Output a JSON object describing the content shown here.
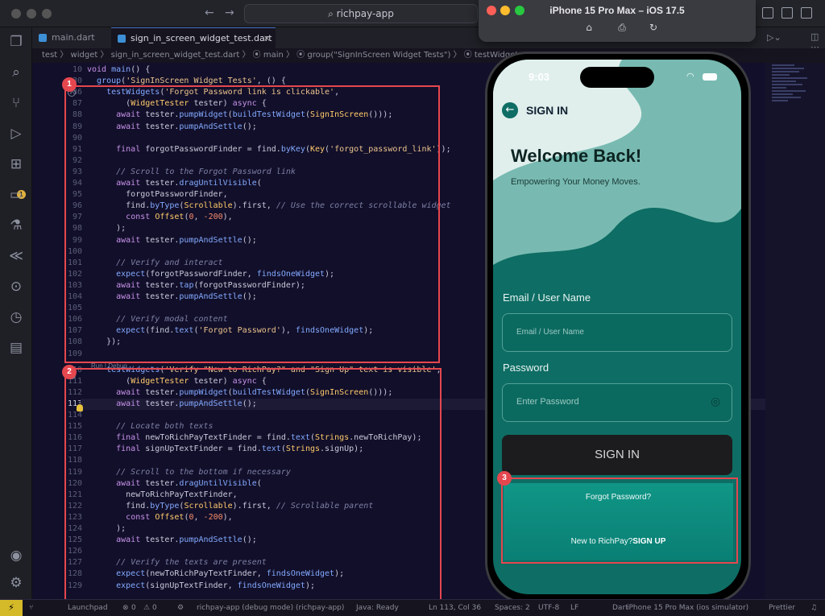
{
  "window": {
    "search": "richpay-app"
  },
  "tabs": [
    {
      "label": "main.dart"
    },
    {
      "label": "sign_in_screen_widget_test.dart",
      "close": "×"
    }
  ],
  "breadcrumb": "test 〉 widget 〉 sign_in_screen_widget_test.dart 〉 ⦿ main 〉 ⦿ group(\"SignInScreen Widget Tests\") 〉 ⦿ testWidget",
  "editor": {
    "codelens": "Run | Debug",
    "current_line": "113",
    "lines": [
      {
        "n": "10",
        "t": "void main() {"
      },
      {
        "n": "30",
        "t": "  group('SignInScreen Widget Tests', () {"
      },
      {
        "n": "86",
        "t": "    testWidgets('Forgot Password link is clickable',"
      },
      {
        "n": "87",
        "t": "        (WidgetTester tester) async {"
      },
      {
        "n": "88",
        "t": "      await tester.pumpWidget(buildTestWidget(SignInScreen()));"
      },
      {
        "n": "89",
        "t": "      await tester.pumpAndSettle();"
      },
      {
        "n": "90",
        "t": ""
      },
      {
        "n": "91",
        "t": "      final forgotPasswordFinder = find.byKey(Key('forgot_password_link'));"
      },
      {
        "n": "92",
        "t": ""
      },
      {
        "n": "93",
        "t": "      // Scroll to the Forgot Password link"
      },
      {
        "n": "94",
        "t": "      await tester.dragUntilVisible("
      },
      {
        "n": "95",
        "t": "        forgotPasswordFinder,"
      },
      {
        "n": "96",
        "t": "        find.byType(Scrollable).first, // Use the correct scrollable widget"
      },
      {
        "n": "97",
        "t": "        const Offset(0, -200),"
      },
      {
        "n": "98",
        "t": "      );"
      },
      {
        "n": "99",
        "t": "      await tester.pumpAndSettle();"
      },
      {
        "n": "100",
        "t": ""
      },
      {
        "n": "101",
        "t": "      // Verify and interact"
      },
      {
        "n": "102",
        "t": "      expect(forgotPasswordFinder, findsOneWidget);"
      },
      {
        "n": "103",
        "t": "      await tester.tap(forgotPasswordFinder);"
      },
      {
        "n": "104",
        "t": "      await tester.pumpAndSettle();"
      },
      {
        "n": "105",
        "t": ""
      },
      {
        "n": "106",
        "t": "      // Verify modal content"
      },
      {
        "n": "107",
        "t": "      expect(find.text('Forgot Password'), findsOneWidget);"
      },
      {
        "n": "108",
        "t": "    });"
      },
      {
        "n": "109",
        "t": ""
      },
      {
        "n": "110",
        "t": "    testWidgets('Verify \"New to RichPay?\" and \"Sign Up\" text is visible',"
      },
      {
        "n": "111",
        "t": "        (WidgetTester tester) async {"
      },
      {
        "n": "112",
        "t": "      await tester.pumpWidget(buildTestWidget(SignInScreen()));"
      },
      {
        "n": "113",
        "t": "      await tester.pumpAndSettle();"
      },
      {
        "n": "114",
        "t": ""
      },
      {
        "n": "115",
        "t": "      // Locate both texts"
      },
      {
        "n": "116",
        "t": "      final newToRichPayTextFinder = find.text(Strings.newToRichPay);"
      },
      {
        "n": "117",
        "t": "      final signUpTextFinder = find.text(Strings.signUp);"
      },
      {
        "n": "118",
        "t": ""
      },
      {
        "n": "119",
        "t": "      // Scroll to the bottom if necessary"
      },
      {
        "n": "120",
        "t": "      await tester.dragUntilVisible("
      },
      {
        "n": "121",
        "t": "        newToRichPayTextFinder,"
      },
      {
        "n": "122",
        "t": "        find.byType(Scrollable).first, // Scrollable parent"
      },
      {
        "n": "123",
        "t": "        const Offset(0, -200),"
      },
      {
        "n": "124",
        "t": "      );"
      },
      {
        "n": "125",
        "t": "      await tester.pumpAndSettle();"
      },
      {
        "n": "126",
        "t": ""
      },
      {
        "n": "127",
        "t": "      // Verify the texts are present"
      },
      {
        "n": "128",
        "t": "      expect(newToRichPayTextFinder, findsOneWidget);"
      },
      {
        "n": "129",
        "t": "      expect(signUpTextFinder, findsOneWidget);"
      }
    ]
  },
  "annotations": [
    "1",
    "2",
    "3"
  ],
  "simulator": {
    "title": "iPhone 15 Pro Max – iOS 17.5"
  },
  "app": {
    "time": "9:03",
    "back_title": "SIGN IN",
    "heading": "Welcome Back!",
    "tagline": "Empowering Your Money Moves.",
    "email_label": "Email / User Name",
    "email_placeholder": "Email / User Name",
    "password_label": "Password",
    "password_placeholder": "Enter Password",
    "signin_button": "SIGN IN",
    "forgot": "Forgot Password?",
    "new_to": "New to RichPay?",
    "signup": "SIGN UP"
  },
  "statusbar": {
    "launchpad": "Launchpad",
    "errors": "0",
    "warnings": "0",
    "debug": "richpay-app (debug mode) (richpay-app)",
    "java": "Java: Ready",
    "position": "Ln 113, Col 36",
    "spaces": "Spaces: 2",
    "encoding": "UTF-8",
    "eol": "LF",
    "lang": "Dart",
    "device": "iPhone 15 Pro Max (ios simulator)",
    "prettier": "Prettier"
  },
  "colors": {
    "accent": "#e5474f",
    "app_teal": "#0e6d64",
    "editor_bg": "#120f2a"
  }
}
